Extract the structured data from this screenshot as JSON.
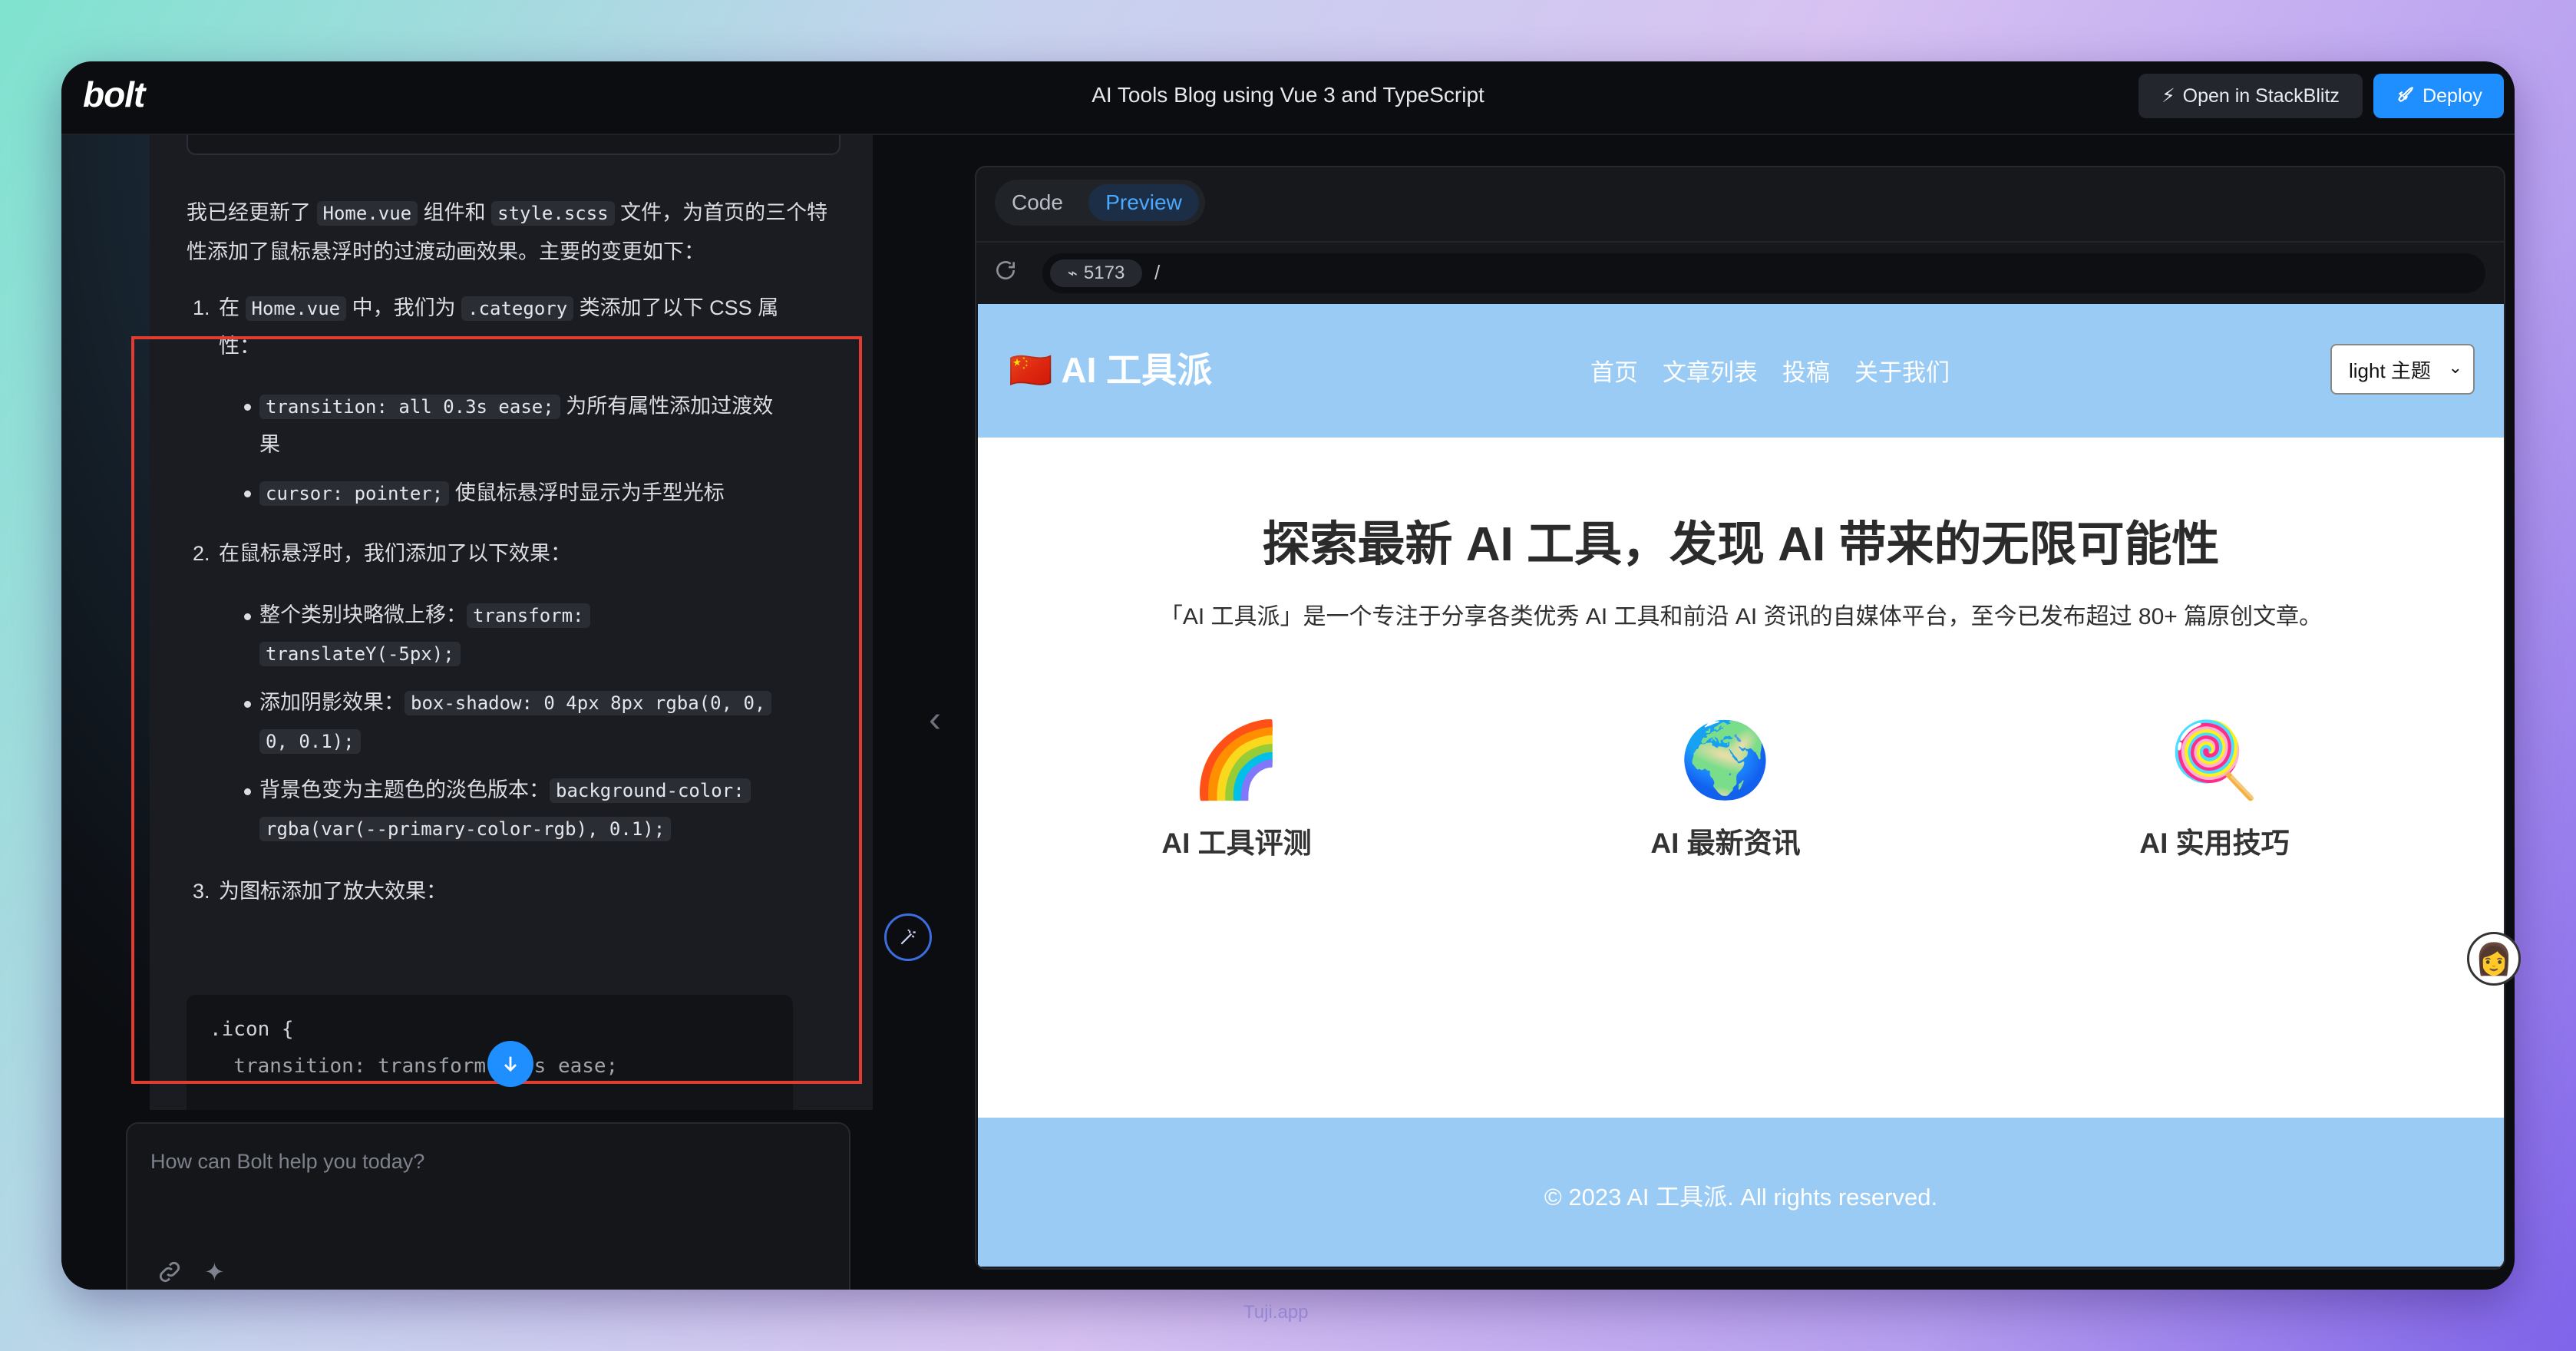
{
  "app": {
    "logo": "bolt",
    "title": "AI Tools Blog using Vue 3 and TypeScript",
    "open_btn": "Open in StackBlitz",
    "deploy_btn": "Deploy"
  },
  "chat": {
    "intro": {
      "p1": "我已经更新了 ",
      "c1": "Home.vue",
      "p2": " 组件和 ",
      "c2": "style.scss",
      "p3": " 文件，为首页的三个特性添加了鼠标悬浮时的过渡动画效果。主要的变更如下："
    },
    "item1": {
      "num": "1.",
      "t1": "在 ",
      "c1": "Home.vue",
      "t2": " 中，我们为 ",
      "c2": ".category",
      "t3": " 类添加了以下 CSS 属",
      "t4": "性：",
      "b1_code": "transition: all 0.3s ease;",
      "b1_text": " 为所有属性添加过渡效",
      "b1_text2": "果",
      "b2_code": "cursor: pointer;",
      "b2_text": " 使鼠标悬浮时显示为手型光标"
    },
    "item2": {
      "num": "2.",
      "text": "在鼠标悬浮时，我们添加了以下效果：",
      "b1_text": "整个类别块略微上移：",
      "b1_code1": "transform:",
      "b1_code2": "translateY(-5px);",
      "b2_text": "添加阴影效果：",
      "b2_code1": "box-shadow: 0 4px 8px rgba(0, 0,",
      "b2_code2": "0, 0.1);",
      "b3_text": "背景色变为主题色的淡色版本：",
      "b3_code1": "background-color:",
      "b3_code2": "rgba(var(--primary-color-rgb), 0.1);"
    },
    "item3": {
      "num": "3.",
      "text": "为图标添加了放大效果："
    },
    "codeblock": {
      "line1": ".icon {",
      "line2": "  transition: transform 0.3s ease;"
    },
    "input_placeholder": "How can Bolt help you today?"
  },
  "preview": {
    "tab_code": "Code",
    "tab_preview": "Preview",
    "port": "5173",
    "path": "/",
    "site": {
      "flag": "🇨🇳",
      "logo": "AI 工具派",
      "nav": [
        "首页",
        "文章列表",
        "投稿",
        "关于我们"
      ],
      "theme_value": "light 主题",
      "hero_title": "探索最新 AI 工具，发现 AI 带来的无限可能性",
      "hero_sub": "「AI 工具派」是一个专注于分享各类优秀 AI 工具和前沿 AI 资讯的自媒体平台，至今已发布超过 80+ 篇原创文章。",
      "features": [
        {
          "emoji": "🌈",
          "label": "AI 工具评测"
        },
        {
          "emoji": "🌍",
          "label": "AI 最新资讯"
        },
        {
          "emoji": "🍭",
          "label": "AI 实用技巧"
        }
      ],
      "footer": "© 2023 AI 工具派. All rights reserved."
    }
  },
  "watermark": "Tuji.app",
  "colors": {
    "accent": "#1f8fff",
    "site_header": "#99cbf5",
    "highlight_box": "#e23b2f"
  }
}
